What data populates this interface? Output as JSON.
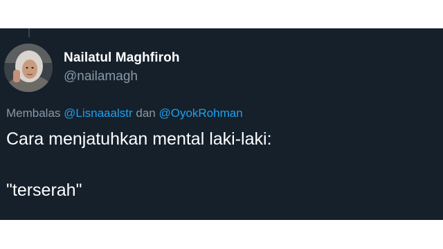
{
  "author": {
    "display_name": "Nailatul Maghfiroh",
    "handle": "@nailamagh"
  },
  "reply_context": {
    "prefix": "Membalas",
    "mention_1": "@Lisnaaalstr",
    "joiner": "dan",
    "mention_2": "@OyokRohman"
  },
  "tweet": {
    "line_1": "Cara menjatuhkan mental laki-laki:",
    "line_2": "\"terserah\""
  },
  "colors": {
    "background": "#15202b",
    "text_primary": "#ffffff",
    "text_secondary": "#8899a6",
    "link": "#1da1f2"
  }
}
